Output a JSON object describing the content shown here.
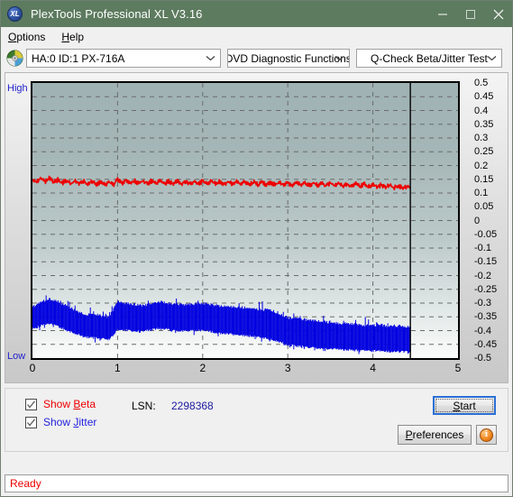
{
  "window": {
    "title": "PlexTools Professional XL V3.16",
    "icon": "xl-app-icon",
    "icon_text": "XL",
    "controls": {
      "minimize": "minimize-icon",
      "maximize": "maximize-icon",
      "close": "close-icon"
    }
  },
  "menu": {
    "items": [
      {
        "label": "Options",
        "accel": "O"
      },
      {
        "label": "Help",
        "accel": "H"
      }
    ]
  },
  "toolbar": {
    "drive_icon": "optical-disc-icon",
    "drive_combo": {
      "value": "HA:0 ID:1  PX-716A",
      "arrow": "chevron-down-icon"
    },
    "function_combo": {
      "value": "DVD Diagnostic Functions",
      "arrow": "chevron-down-icon"
    },
    "test_combo": {
      "value": "Q-Check Beta/Jitter Test",
      "arrow": "chevron-down-icon"
    }
  },
  "chart_data": {
    "type": "line",
    "title": "Q-Check Beta/Jitter Test",
    "xlabel": "",
    "ylabel": "",
    "y_left_labels": {
      "high": "High",
      "low": "Low"
    },
    "xlim": [
      0,
      5
    ],
    "ylim": [
      -0.5,
      0.5
    ],
    "grid": true,
    "x_ticks": [
      "0",
      "1",
      "2",
      "3",
      "4",
      "5"
    ],
    "y_ticks": [
      "0.5",
      "0.45",
      "0.4",
      "0.35",
      "0.3",
      "0.25",
      "0.2",
      "0.15",
      "0.1",
      "0.05",
      "0",
      "-0.05",
      "-0.1",
      "-0.15",
      "-0.2",
      "-0.25",
      "-0.3",
      "-0.35",
      "-0.4",
      "-0.45",
      "-0.5"
    ],
    "data_end_x": 4.44,
    "colors": {
      "beta": "#ee0000",
      "jitter": "#0000e0"
    },
    "series": [
      {
        "name": "Beta",
        "color": "#ee0000",
        "x": [
          0.0,
          0.05,
          0.1,
          0.15,
          0.2,
          0.25,
          0.3,
          0.35,
          0.4,
          0.45,
          0.5,
          0.55,
          0.6,
          0.65,
          0.7,
          0.75,
          0.8,
          0.85,
          0.9,
          0.95,
          1.0,
          1.05,
          1.1,
          1.15,
          1.2,
          1.25,
          1.3,
          1.35,
          1.4,
          1.45,
          1.5,
          1.55,
          1.6,
          1.65,
          1.7,
          1.75,
          1.8,
          1.85,
          1.9,
          1.95,
          2.0,
          2.05,
          2.1,
          2.15,
          2.2,
          2.25,
          2.3,
          2.35,
          2.4,
          2.45,
          2.5,
          2.55,
          2.6,
          2.65,
          2.7,
          2.75,
          2.8,
          2.85,
          2.9,
          2.95,
          3.0,
          3.05,
          3.1,
          3.15,
          3.2,
          3.25,
          3.3,
          3.35,
          3.4,
          3.45,
          3.5,
          3.55,
          3.6,
          3.65,
          3.7,
          3.75,
          3.8,
          3.85,
          3.9,
          3.95,
          4.0,
          4.05,
          4.1,
          4.15,
          4.2,
          4.25,
          4.3,
          4.35,
          4.4,
          4.44
        ],
        "values": [
          0.15,
          0.142,
          0.152,
          0.14,
          0.154,
          0.139,
          0.148,
          0.136,
          0.146,
          0.134,
          0.144,
          0.133,
          0.143,
          0.132,
          0.142,
          0.131,
          0.141,
          0.13,
          0.14,
          0.13,
          0.148,
          0.136,
          0.146,
          0.135,
          0.145,
          0.134,
          0.145,
          0.134,
          0.144,
          0.134,
          0.144,
          0.133,
          0.143,
          0.133,
          0.143,
          0.133,
          0.143,
          0.133,
          0.143,
          0.133,
          0.144,
          0.134,
          0.144,
          0.133,
          0.143,
          0.132,
          0.142,
          0.132,
          0.142,
          0.131,
          0.141,
          0.131,
          0.14,
          0.13,
          0.14,
          0.13,
          0.139,
          0.129,
          0.139,
          0.129,
          0.138,
          0.128,
          0.138,
          0.128,
          0.137,
          0.127,
          0.137,
          0.127,
          0.136,
          0.126,
          0.136,
          0.126,
          0.135,
          0.125,
          0.134,
          0.124,
          0.133,
          0.124,
          0.132,
          0.123,
          0.131,
          0.122,
          0.13,
          0.121,
          0.128,
          0.119,
          0.126,
          0.118,
          0.123,
          0.118
        ]
      },
      {
        "name": "Jitter",
        "color": "#0000e0",
        "x": [
          0.0,
          0.1,
          0.2,
          0.3,
          0.4,
          0.5,
          0.6,
          0.7,
          0.8,
          0.9,
          1.0,
          1.1,
          1.2,
          1.3,
          1.4,
          1.5,
          1.6,
          1.7,
          1.8,
          1.9,
          2.0,
          2.1,
          2.2,
          2.3,
          2.4,
          2.5,
          2.6,
          2.7,
          2.8,
          2.9,
          3.0,
          3.1,
          3.2,
          3.3,
          3.4,
          3.5,
          3.6,
          3.7,
          3.8,
          3.9,
          4.0,
          4.1,
          4.2,
          4.3,
          4.4,
          4.44
        ],
        "upper": [
          -0.32,
          -0.3,
          -0.29,
          -0.3,
          -0.315,
          -0.33,
          -0.345,
          -0.345,
          -0.35,
          -0.355,
          -0.3,
          -0.305,
          -0.31,
          -0.315,
          -0.305,
          -0.3,
          -0.305,
          -0.31,
          -0.31,
          -0.308,
          -0.305,
          -0.31,
          -0.315,
          -0.318,
          -0.32,
          -0.322,
          -0.325,
          -0.328,
          -0.33,
          -0.345,
          -0.358,
          -0.362,
          -0.365,
          -0.368,
          -0.372,
          -0.375,
          -0.378,
          -0.38,
          -0.382,
          -0.385,
          -0.385,
          -0.385,
          -0.388,
          -0.388,
          -0.39,
          -0.39
        ],
        "lower": [
          -0.39,
          -0.378,
          -0.372,
          -0.38,
          -0.395,
          -0.405,
          -0.418,
          -0.422,
          -0.425,
          -0.428,
          -0.392,
          -0.395,
          -0.398,
          -0.4,
          -0.392,
          -0.388,
          -0.392,
          -0.398,
          -0.398,
          -0.396,
          -0.395,
          -0.4,
          -0.405,
          -0.408,
          -0.412,
          -0.415,
          -0.418,
          -0.422,
          -0.428,
          -0.438,
          -0.448,
          -0.452,
          -0.455,
          -0.458,
          -0.46,
          -0.462,
          -0.464,
          -0.466,
          -0.468,
          -0.47,
          -0.47,
          -0.47,
          -0.472,
          -0.472,
          -0.474,
          -0.474
        ]
      }
    ]
  },
  "options": {
    "show_beta": {
      "label_prefix": "Show ",
      "label_accel": "B",
      "label_suffix": "eta",
      "checked": true,
      "color": "#ee0000"
    },
    "show_jitter": {
      "label_prefix": "Show ",
      "label_accel": "J",
      "label_suffix": "itter",
      "checked": true,
      "color": "#2222dd"
    },
    "lsn_label": "LSN:",
    "lsn_value": "2298368",
    "start_button": {
      "prefix": "",
      "accel": "S",
      "suffix": "tart"
    },
    "preferences_button": {
      "prefix": "",
      "accel": "P",
      "suffix": "references"
    },
    "info_button": {
      "icon": "info-icon",
      "glyph": "i"
    }
  },
  "status": {
    "text": "Ready"
  }
}
